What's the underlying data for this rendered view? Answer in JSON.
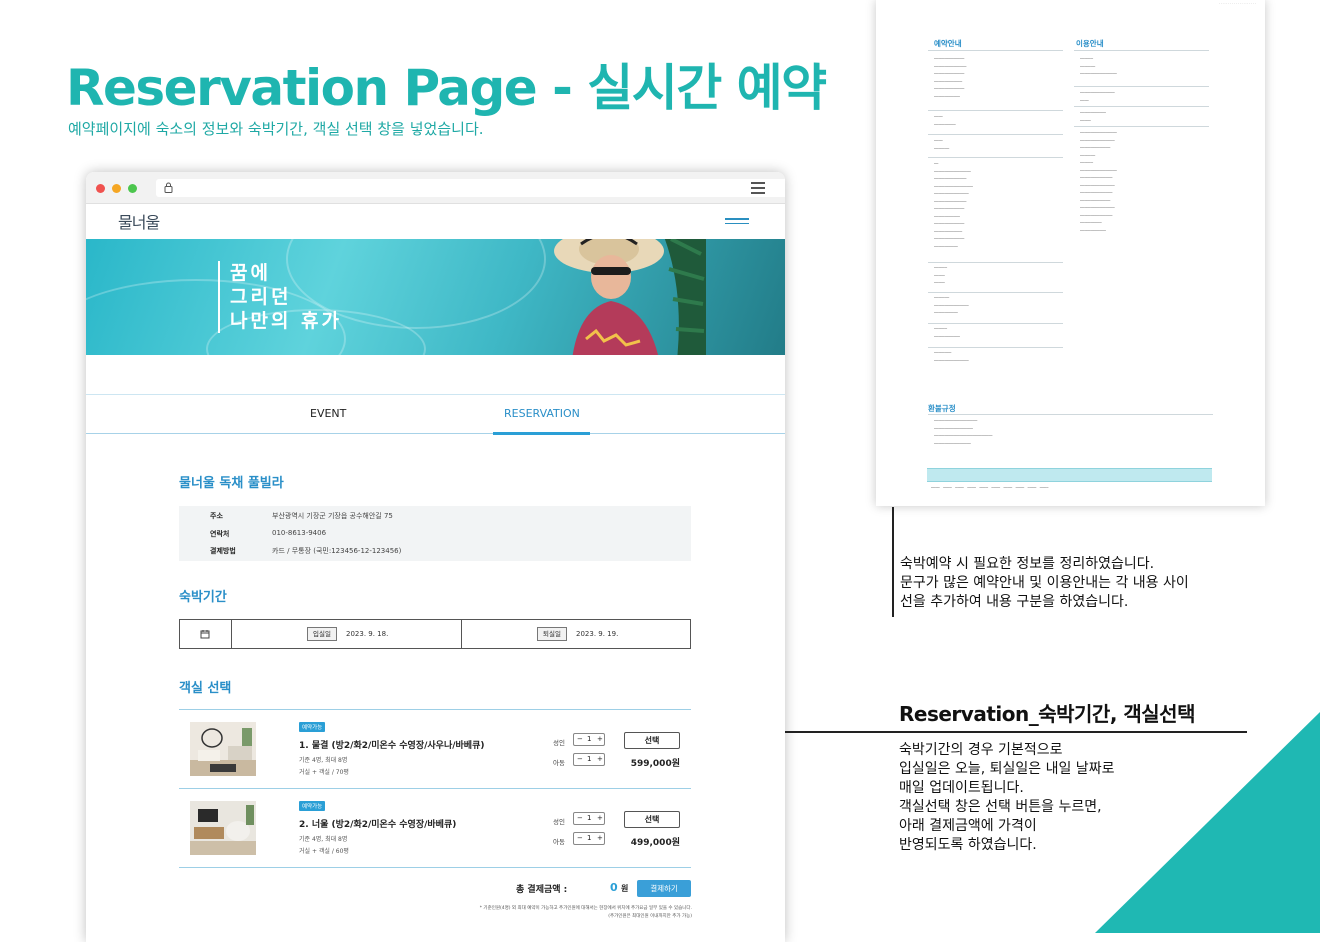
{
  "heading": {
    "title": "Reservation Page - 실시간 예약",
    "subtitle": "예약페이지에  숙소의 정보와 숙박기간,  객실 선택 창을 넣었습니다."
  },
  "browser": {
    "logo": "물너울",
    "hero_text": [
      "꿈에",
      "그리던",
      "나만의 휴가"
    ],
    "tabs": [
      "EVENT",
      "RESERVATION"
    ],
    "active_tab": "RESERVATION",
    "property": {
      "title": "물너울 독채 풀빌라",
      "rows": [
        {
          "key": "주소",
          "value": "부산광역시 기장군 기장읍 공수해안길 75"
        },
        {
          "key": "연락처",
          "value": "010-8613-9406"
        },
        {
          "key": "결제방법",
          "value": "카드 / 무통장 (국민:123456-12-123456)"
        }
      ]
    },
    "stay": {
      "title": "숙박기간",
      "checkin_label": "입실일",
      "checkin_value": "2023. 9. 18.",
      "checkout_label": "퇴실일",
      "checkout_value": "2023. 9. 19."
    },
    "rooms": {
      "title": "객실 선택",
      "items": [
        {
          "badge": "예약가능",
          "name": "1. 물결 (방2/화2/미온수 수영장/사우나/바베큐)",
          "capacity": "기준 4명, 최대 8명",
          "layout": "거실 + 객실 / 70평",
          "adult_label": "성인",
          "adult_count": "1",
          "child_label": "아동",
          "child_count": "1",
          "select_label": "선택",
          "price": "599,000원"
        },
        {
          "badge": "예약가능",
          "name": "2. 너울 (방2/화2/미온수 수영장/바베큐)",
          "capacity": "기준 4명, 최대 8명",
          "layout": "거실 + 객실 / 60평",
          "adult_label": "성인",
          "adult_count": "1",
          "child_label": "아동",
          "child_count": "1",
          "select_label": "선택",
          "price": "499,000원"
        }
      ]
    },
    "total": {
      "label": "총 결제금액 :",
      "value": "0",
      "unit": "원",
      "pay_label": "결제하기"
    },
    "fine_print": [
      "* 기준인원(4명) 외 최대 예약이 가능하고 추가인원에 대해서는 현장에서 위치에 추가요금 일부 있을 수 있습니다.",
      "(추가인원은 최대인원 이내까지만 추가 가능)"
    ]
  },
  "document": {
    "sections": [
      "예약안내",
      "이용안내",
      "환불규정"
    ]
  },
  "notes": {
    "note1": [
      "숙박예약 시 필요한 정보를 정리하였습니다.",
      "문구가 많은 예약안내 및 이용안내는 각 내용 사이",
      "선을 추가하여 내용 구분을 하였습니다."
    ],
    "section_title": "Reservation_숙박기간, 객실선택",
    "note2": [
      "숙박기간의 경우 기본적으로",
      "입실일은 오늘, 퇴실일은 내일 날짜로",
      "매일 업데이트됩니다.",
      "객실선택 창은 선택 버튼을 누르면,",
      "아래 결제금액에 가격이",
      "반영되도록 하였습니다."
    ]
  },
  "colors": {
    "accent": "#1fb5b0",
    "site_blue": "#2a9fd6"
  }
}
